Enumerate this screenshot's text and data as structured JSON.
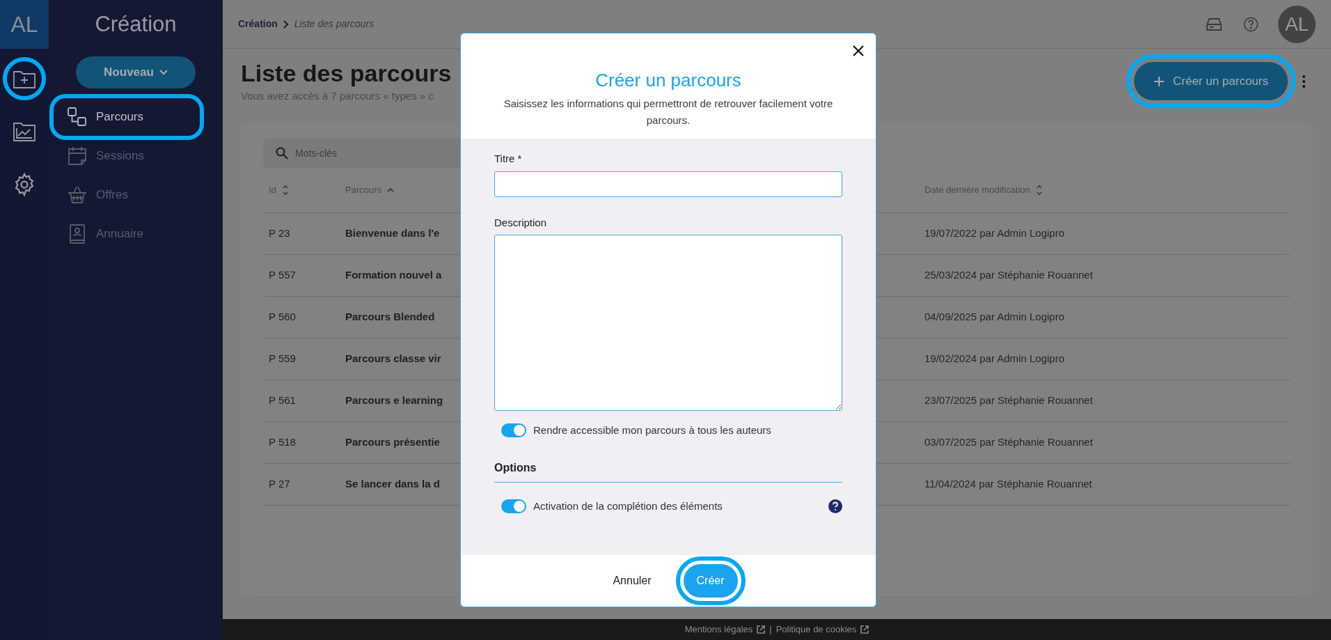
{
  "rail": {
    "logo": "AL",
    "items": [
      {
        "selected": false,
        "highlighted": true
      },
      {
        "selected": false,
        "highlighted": false
      },
      {
        "selected": false,
        "highlighted": false
      }
    ]
  },
  "sidebar": {
    "title": "Création",
    "new_button": "Nouveau",
    "items": [
      {
        "label": "Parcours",
        "selected": true,
        "highlighted": true
      },
      {
        "label": "Sessions",
        "selected": false,
        "highlighted": false
      },
      {
        "label": "Offres",
        "selected": false,
        "highlighted": false
      },
      {
        "label": "Annuaire",
        "selected": false,
        "highlighted": false
      }
    ]
  },
  "breadcrumb": {
    "parent": "Création",
    "current": "Liste des parcours"
  },
  "user": {
    "initials": "AL"
  },
  "page": {
    "title": "Liste des parcours",
    "subtitle": "Vous avez accès à 7 parcours « types » c",
    "create_button": {
      "label": "Créer un parcours",
      "highlighted": true
    }
  },
  "search": {
    "placeholder": "Mots-clés"
  },
  "table": {
    "columns": [
      {
        "label": "Id",
        "sorted": false
      },
      {
        "label": "Parcours",
        "sorted": true
      },
      {
        "label": "Date dernière modification",
        "sorted": false
      }
    ],
    "rows": [
      {
        "id": "P 23",
        "name": "Bienvenue dans l'e",
        "date": "19/07/2022 par Admin Logipro"
      },
      {
        "id": "P 557",
        "name": "Formation nouvel a",
        "date": "25/03/2024 par Stéphanie Rouannet"
      },
      {
        "id": "P 560",
        "name": "Parcours Blended",
        "date": "04/09/2025 par Admin Logipro"
      },
      {
        "id": "P 559",
        "name": "Parcours classe vir",
        "date": "19/02/2024 par Admin Logipro"
      },
      {
        "id": "P 561",
        "name": "Parcours e learning",
        "date": "23/07/2025 par Stéphanie Rouannet"
      },
      {
        "id": "P 518",
        "name": "Parcours présentie",
        "date": "03/07/2025 par Stéphanie Rouannet"
      },
      {
        "id": "P 27",
        "name": "Se lancer dans la d",
        "date": "11/04/2024 par Stéphanie Rouannet"
      }
    ]
  },
  "modal": {
    "title": "Créer un parcours",
    "subtitle": "Saisissez les informations qui permettront de retrouver facilement votre parcours.",
    "title_label": "Titre *",
    "description_label": "Description",
    "share_toggle": {
      "label": "Rendre accessible mon parcours à tous les auteurs",
      "on": true
    },
    "options_heading": "Options",
    "completion_toggle": {
      "label": "Activation de la complétion des éléments",
      "on": true
    },
    "cancel": "Annuler",
    "submit": {
      "label": "Créer",
      "highlighted": true
    }
  },
  "footer": {
    "links": [
      "Mentions légales",
      "Politique de cookies"
    ],
    "separator": "|"
  }
}
